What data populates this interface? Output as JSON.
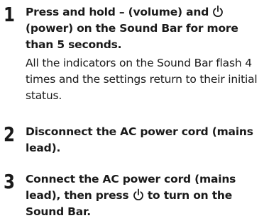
{
  "steps": [
    {
      "number": "1",
      "instruction": {
        "part1": "Press and hold – (volume) and ",
        "power_icon": "power-icon",
        "part2": " (power) on the Sound Bar for more than 5 seconds."
      },
      "result": "All the indicators on the Sound Bar flash 4 times and the settings return to their initial status."
    },
    {
      "number": "2",
      "instruction": {
        "part1": "Disconnect the AC power cord (mains lead)."
      }
    },
    {
      "number": "3",
      "instruction": {
        "part1": "Connect the AC power cord (mains lead), then press ",
        "power_icon": "power-icon",
        "part2": " to turn on the Sound Bar."
      }
    }
  ]
}
